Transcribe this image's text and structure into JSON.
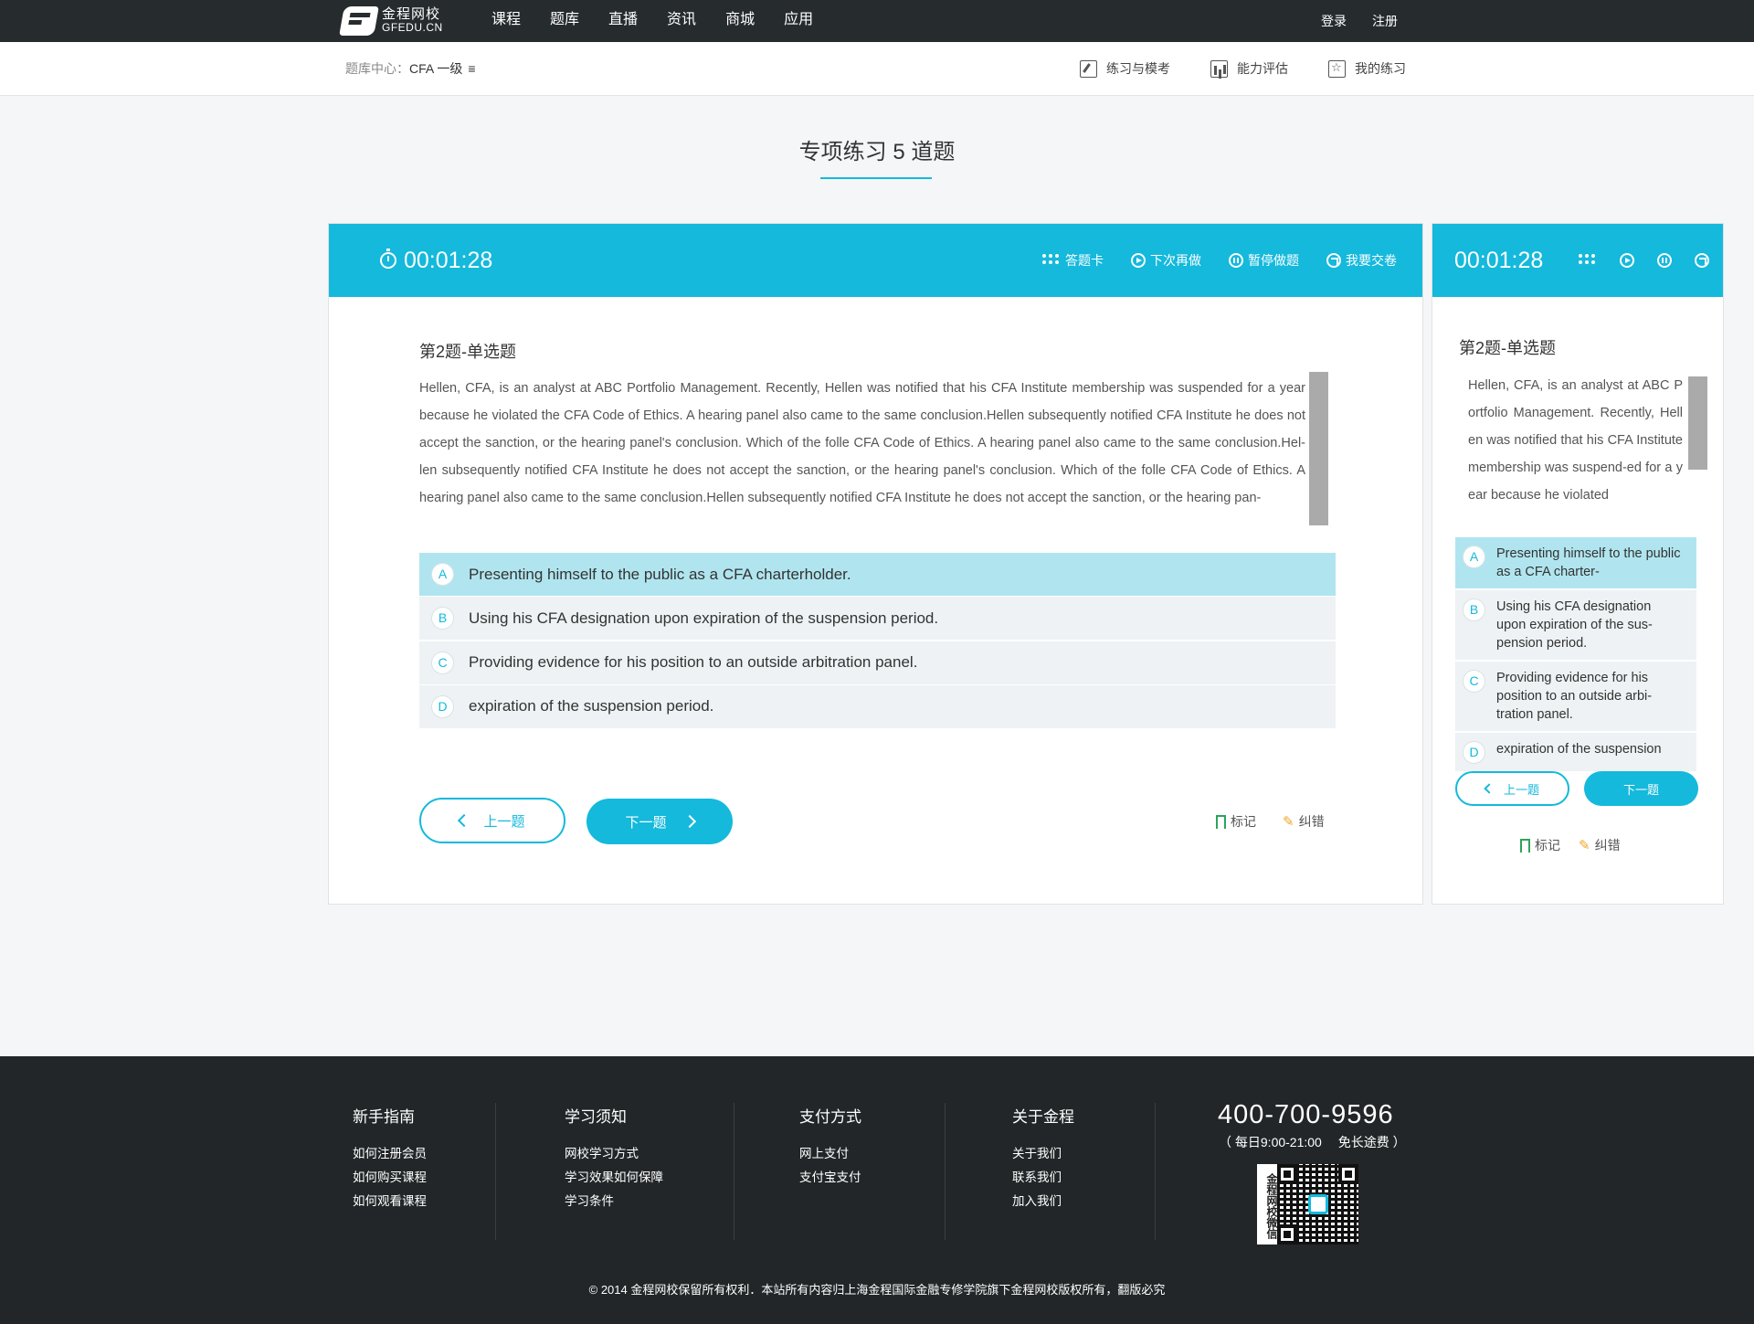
{
  "nav": {
    "logo_cn": "金程网校",
    "logo_en": "GFEDU.CN",
    "links": [
      "课程",
      "题库",
      "直播",
      "资讯",
      "商城",
      "应用"
    ],
    "login": "登录",
    "register": "注册"
  },
  "subbar": {
    "crumb_root": "题库中心：",
    "crumb_current": "CFA 一级",
    "menu_icon": "≡",
    "tools": [
      "练习与模考",
      "能力评估",
      "我的练习"
    ]
  },
  "page": {
    "title": "专项练习 5 道题"
  },
  "quiz": {
    "timer": "00:01:28",
    "tools": {
      "answer_card": "答题卡",
      "do_later": "下次再做",
      "pause": "暂停做题",
      "submit": "我要交卷"
    },
    "question_title": "第2题-单选题",
    "stem": "Hellen, CFA, is an analyst at ABC Portfolio Management. Recently, Hellen was notified that his CFA Institute membership was suspended for a year because he violated the CFA Code of Ethics. A hearing panel also came to the same conclusion.Hellen subsequently notified CFA Institute he does not accept the sanction, or the hearing panel's conclusion. Which of the folle CFA Code of Ethics. A hearing panel also came to the same conclusion.Hel-len subsequently notified CFA Institute he does not accept the sanction, or the hearing panel's conclusion. Which of the folle CFA Code of Ethics. A hearing panel also came to the same conclusion.Hellen subsequently notified CFA Institute he does not accept the sanction, or the hearing pan-",
    "options": [
      {
        "letter": "A",
        "text": "Presenting himself to the public as a CFA charterholder."
      },
      {
        "letter": "B",
        "text": "Using his CFA designation upon expiration of the suspension period."
      },
      {
        "letter": "C",
        "text": "Providing evidence for his position to an outside arbitration panel."
      },
      {
        "letter": "D",
        "text": "expiration of the suspension period."
      }
    ],
    "selected": "A",
    "prev_label": "上一题",
    "next_label": "下一题",
    "mark_label": "标记",
    "correct_label": "纠错"
  },
  "mobile": {
    "timer": "00:01:28",
    "question_title": "第2题-单选题",
    "stem": "Hellen, CFA, is an analyst at ABC Portfolio Management. Recently, Hellen was notified that his CFA Institute membership was suspend-ed for a year because he violated",
    "options": [
      {
        "letter": "A",
        "text": "Presenting himself to the public as a CFA charter-"
      },
      {
        "letter": "B",
        "text": "Using his CFA designation upon expiration of the sus-pension period."
      },
      {
        "letter": "C",
        "text": "Providing evidence for his position to an outside arbi-tration panel."
      },
      {
        "letter": "D",
        "text": "expiration of the suspension"
      }
    ],
    "prev_label": "上一题",
    "next_label": "下一题",
    "mark_label": "标记",
    "correct_label": "纠错"
  },
  "footer": {
    "columns": [
      {
        "title": "新手指南",
        "links": [
          "如何注册会员",
          "如何购买课程",
          "如何观看课程"
        ]
      },
      {
        "title": "学习须知",
        "links": [
          "网校学习方式",
          "学习效果如何保障",
          "学习条件"
        ]
      },
      {
        "title": "支付方式",
        "links": [
          "网上支付",
          "支付宝支付"
        ]
      },
      {
        "title": "关于金程",
        "links": [
          "关于我们",
          "联系我们",
          "加入我们"
        ]
      }
    ],
    "phone": "400-700-9596",
    "hours": "（ 每日9:00-21:00　 免长途费 ）",
    "qr_label": "金程网校微信",
    "copyright": "© 2014 金程网校保留所有权利．本站所有内容归上海金程国际金融专修学院旗下金程网校版权所有，翻版必究"
  },
  "colors": {
    "accent": "#14b9dc",
    "selected_option": "#b0e5ef",
    "option_bg": "#eef2f4",
    "nav_bg": "#262b2e",
    "footer_bg": "#222628"
  }
}
